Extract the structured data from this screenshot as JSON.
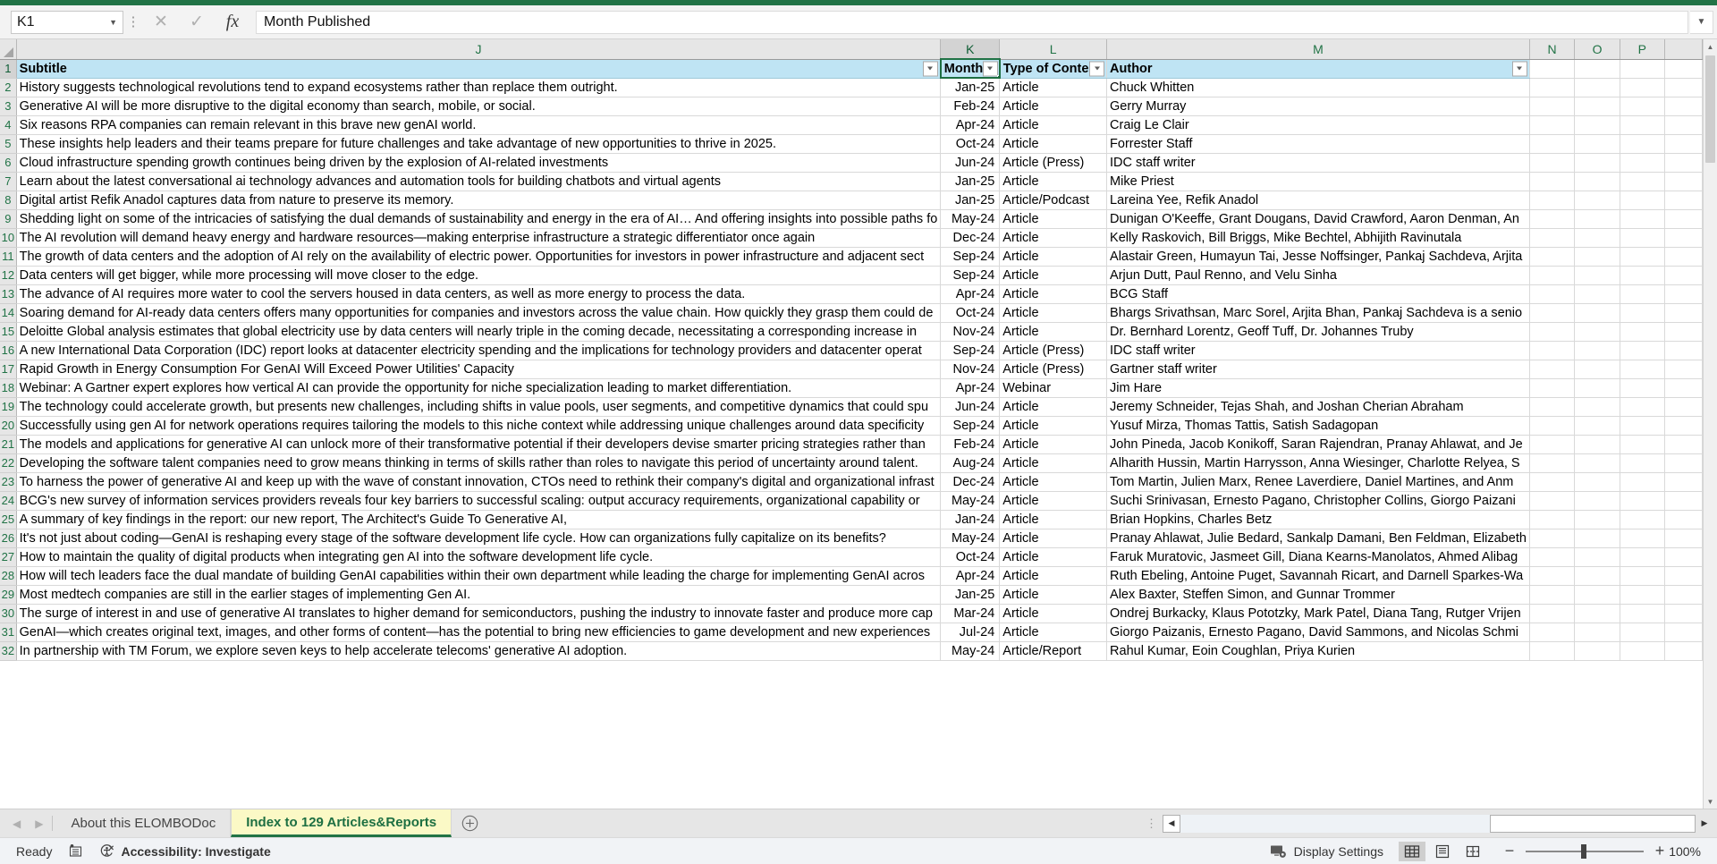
{
  "formula_bar": {
    "name_box_value": "K1",
    "cancel_icon": "cancel-x-icon",
    "confirm_icon": "confirm-check-icon",
    "function_icon": "fx-insert-function-icon",
    "formula_value": "Month Published",
    "expand_icon": "chevron-down-icon"
  },
  "grid": {
    "columns": [
      "J",
      "K",
      "L",
      "M",
      "N",
      "O",
      "P"
    ],
    "active_column": "K",
    "headers": {
      "J": "Subtitle",
      "K": "Month P",
      "L": "Type of Content",
      "M": "Author"
    },
    "rows": [
      {
        "n": "2",
        "subtitle": "History suggests technological revolutions tend to expand ecosystems rather than replace them outright.",
        "month": "Jan-25",
        "type": "Article",
        "author": "Chuck Whitten"
      },
      {
        "n": "3",
        "subtitle": "Generative AI will be more disruptive to the digital economy than search, mobile, or social.",
        "month": "Feb-24",
        "type": "Article",
        "author": "Gerry Murray"
      },
      {
        "n": "4",
        "subtitle": "Six reasons RPA companies can remain relevant in this brave new genAI world.",
        "month": "Apr-24",
        "type": "Article",
        "author": "Craig Le Clair"
      },
      {
        "n": "5",
        "subtitle": "These insights help leaders and their teams prepare for future challenges and take advantage of new opportunities to thrive in 2025.",
        "month": "Oct-24",
        "type": "Article",
        "author": "Forrester Staff"
      },
      {
        "n": "6",
        "subtitle": "Cloud infrastructure spending growth continues being driven by the explosion of AI-related investments",
        "month": "Jun-24",
        "type": "Article (Press)",
        "author": "IDC staff writer"
      },
      {
        "n": "7",
        "subtitle": "Learn about the latest conversational ai technology advances and automation tools for building chatbots and virtual agents",
        "month": "Jan-25",
        "type": "Article",
        "author": "Mike Priest"
      },
      {
        "n": "8",
        "subtitle": "Digital artist Refik Anadol captures data from nature to preserve its memory.",
        "month": "Jan-25",
        "type": "Article/Podcast",
        "author": "Lareina Yee, Refik Anadol"
      },
      {
        "n": "9",
        "subtitle": "Shedding light on some of the intricacies of satisfying the dual demands of sustainability and energy in the era of AI… And offering insights into possible paths fo",
        "month": "May-24",
        "type": "Article",
        "author": "Dunigan O'Keeffe, Grant Dougans, David Crawford, Aaron Denman, An"
      },
      {
        "n": "10",
        "subtitle": "The AI revolution will demand heavy energy and hardware resources—making enterprise infrastructure a strategic differentiator once again",
        "month": "Dec-24",
        "type": "Article",
        "author": "Kelly Raskovich, Bill Briggs, Mike Bechtel, Abhijith Ravinutala"
      },
      {
        "n": "11",
        "subtitle": "The growth of data centers and the adoption of AI rely on the availability of electric power. Opportunities for investors in power infrastructure and adjacent sect",
        "month": "Sep-24",
        "type": "Article",
        "author": "Alastair Green, Humayun Tai, Jesse Noffsinger, Pankaj Sachdeva, Arjita"
      },
      {
        "n": "12",
        "subtitle": "Data centers will get bigger, while more processing will move closer to the edge.",
        "month": "Sep-24",
        "type": "Article",
        "author": "Arjun Dutt, Paul Renno, and Velu Sinha"
      },
      {
        "n": "13",
        "subtitle": "The advance of AI requires more water to cool the servers housed in data centers, as well as more energy to process the data.",
        "month": "Apr-24",
        "type": "Article",
        "author": "BCG Staff"
      },
      {
        "n": "14",
        "subtitle": "Soaring demand for AI-ready data centers offers many opportunities for companies and investors across the value chain. How quickly they grasp them could de",
        "month": "Oct-24",
        "type": "Article",
        "author": "Bhargs Srivathsan, Marc Sorel, Arjita Bhan, Pankaj Sachdeva is a senio"
      },
      {
        "n": "15",
        "subtitle": "Deloitte Global analysis estimates that global electricity use by data centers will nearly triple in the coming decade, necessitating a corresponding increase in ",
        "month": "Nov-24",
        "type": "Article",
        "author": "Dr. Bernhard Lorentz, Geoff Tuff, Dr. Johannes Truby"
      },
      {
        "n": "16",
        "subtitle": "A new International Data Corporation (IDC) report looks at datacenter electricity spending and the implications for technology providers and datacenter operat",
        "month": "Sep-24",
        "type": "Article (Press)",
        "author": "IDC staff writer"
      },
      {
        "n": "17",
        "subtitle": "Rapid Growth in Energy Consumption For GenAI Will Exceed Power Utilities' Capacity",
        "month": "Nov-24",
        "type": "Article (Press)",
        "author": "Gartner staff writer"
      },
      {
        "n": "18",
        "subtitle": "Webinar: A Gartner expert explores how vertical AI can provide the opportunity for niche specialization leading to market differentiation.",
        "month": "Apr-24",
        "type": "Webinar",
        "author": "Jim Hare"
      },
      {
        "n": "19",
        "subtitle": "The technology could accelerate growth, but presents new challenges, including shifts in value pools, user segments, and competitive dynamics that could spu",
        "month": "Jun-24",
        "type": "Article",
        "author": "Jeremy Schneider, Tejas Shah, and Joshan Cherian Abraham"
      },
      {
        "n": "20",
        "subtitle": "Successfully using gen AI for network operations requires tailoring the models to this niche context while addressing unique challenges around data specificity",
        "month": "Sep-24",
        "type": "Article",
        "author": "Yusuf Mirza, Thomas Tattis, Satish Sadagopan"
      },
      {
        "n": "21",
        "subtitle": "The models and applications for generative AI can unlock more of their transformative potential if their developers devise smarter pricing strategies rather than",
        "month": "Feb-24",
        "type": "Article",
        "author": "John Pineda, Jacob Konikoff, Saran Rajendran,  Pranay Ahlawat, and  Je"
      },
      {
        "n": "22",
        "subtitle": "Developing the software talent companies need to grow means thinking in terms of skills rather than roles to navigate this period of uncertainty around talent.",
        "month": "Aug-24",
        "type": "Article",
        "author": "Alharith Hussin, Martin Harrysson, Anna Wiesinger, Charlotte Relyea, S"
      },
      {
        "n": "23",
        "subtitle": "To harness the power of generative AI and keep up with the wave of constant innovation, CTOs need to rethink their company's digital and organizational infrast",
        "month": "Dec-24",
        "type": "Article",
        "author": "Tom Martin, Julien Marx,  Renee Laverdiere,  Daniel Martines, and  Anm"
      },
      {
        "n": "24",
        "subtitle": "BCG's new survey of information services providers reveals four key barriers to successful scaling: output accuracy requirements, organizational capability or",
        "month": "May-24",
        "type": "Article",
        "author": "Suchi Srinivasan,  Ernesto Pagano, Christopher Collins,  Giorgo Paizani"
      },
      {
        "n": "25",
        "subtitle": "A summary of key findings in the report: our new report, The Architect's Guide To Generative AI,",
        "month": "Jan-24",
        "type": "Article",
        "author": "Brian Hopkins, Charles Betz"
      },
      {
        "n": "26",
        "subtitle": "It's not just about coding—GenAI is reshaping every stage of the software development life cycle. How can organizations fully capitalize on its benefits?",
        "month": "May-24",
        "type": "Article",
        "author": "Pranay Ahlawat, Julie Bedard, Sankalp Damani, Ben Feldman, Elizabeth"
      },
      {
        "n": "27",
        "subtitle": "How to maintain the quality of digital products when integrating gen AI into the software development life cycle.",
        "month": "Oct-24",
        "type": "Article",
        "author": "Faruk Muratovic, Jasmeet Gill, Diana Kearns-Manolatos, Ahmed Alibag"
      },
      {
        "n": "28",
        "subtitle": "How will tech leaders face the dual mandate of building GenAI capabilities within their own department while leading the charge for implementing GenAI acros",
        "month": "Apr-24",
        "type": "Article",
        "author": "Ruth Ebeling, Antoine Puget, Savannah Ricart, and Darnell Sparkes-Wa"
      },
      {
        "n": "29",
        "subtitle": "Most medtech companies are still in the earlier stages of implementing Gen AI.",
        "month": "Jan-25",
        "type": "Article",
        "author": "Alex Baxter,  Steffen Simon, and  Gunnar Trommer"
      },
      {
        "n": "30",
        "subtitle": "The surge of interest in and use of generative AI translates to higher demand for semiconductors, pushing the industry to innovate faster and produce more cap",
        "month": "Mar-24",
        "type": "Article",
        "author": "Ondrej Burkacky, Klaus Pototzky, Mark Patel, Diana Tang, Rutger Vrijen"
      },
      {
        "n": "31",
        "subtitle": "GenAI—which creates original text, images, and other forms of content—has the potential to bring new efficiencies to game development and new experiences",
        "month": "Jul-24",
        "type": "Article",
        "author": "Giorgo Paizanis,  Ernesto Pagano, David Sammons, and  Nicolas Schmi"
      },
      {
        "n": "32",
        "subtitle": "In partnership with TM Forum, we explore seven keys to help accelerate telecoms' generative AI adoption.",
        "month": "May-24",
        "type": "Article/Report",
        "author": "Rahul Kumar, Eoin Coughlan, Priya Kurien"
      }
    ]
  },
  "tabbar": {
    "prev_icon": "arrow-left-icon",
    "next_icon": "arrow-right-icon",
    "tabs": [
      {
        "label": "About this ELOMBODoc",
        "active": false
      },
      {
        "label": "Index to 129 Articles&Reports",
        "active": true
      }
    ],
    "add_sheet_icon": "plus-circle-icon",
    "scroll_left_icon": "scroll-left-arrow-icon",
    "scroll_right_icon": "scroll-right-arrow-icon"
  },
  "statusbar": {
    "mode": "Ready",
    "macro_icon": "record-macro-icon",
    "accessibility_icon": "accessibility-icon",
    "accessibility": "Accessibility: Investigate",
    "display_settings_icon": "display-settings-icon",
    "display_settings": "Display Settings",
    "view_normal_icon": "normal-view-icon",
    "view_pagelayout_icon": "page-layout-view-icon",
    "view_pagebreak_icon": "page-break-view-icon",
    "zoom_out_label": "−",
    "zoom_in_label": "+",
    "zoom_level": "100%"
  },
  "colors": {
    "excel_green": "#217346",
    "header_fill": "#bfe4f4",
    "active_tab_fill": "#fbf9c6"
  }
}
